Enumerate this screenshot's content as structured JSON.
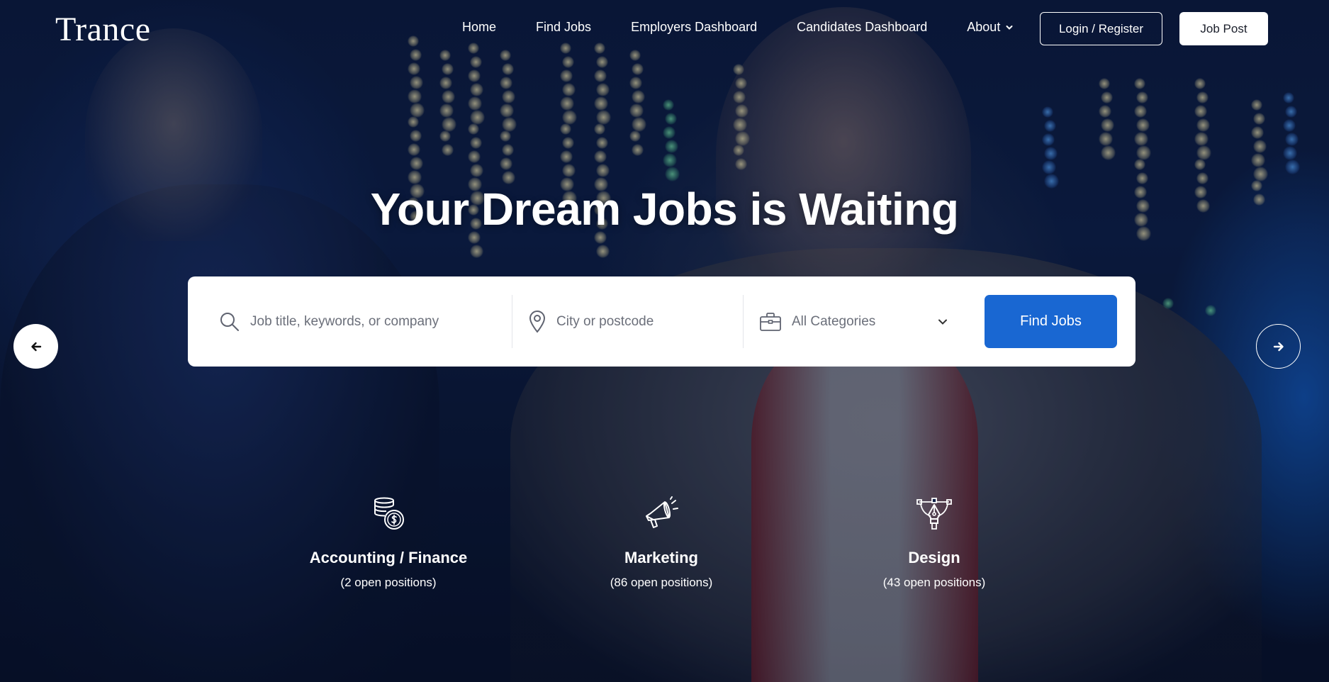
{
  "header": {
    "logo": "Trance",
    "nav": [
      {
        "label": "Home"
      },
      {
        "label": "Find Jobs"
      },
      {
        "label": "Employers Dashboard"
      },
      {
        "label": "Candidates Dashboard"
      },
      {
        "label": "About",
        "has_dropdown": true
      }
    ],
    "login_label": "Login / Register",
    "job_post_label": "Job Post"
  },
  "hero": {
    "headline": "Your Dream Jobs is Waiting"
  },
  "search": {
    "keyword_placeholder": "Job title, keywords, or company",
    "keyword_icon": "search-icon",
    "city_placeholder": "City or postcode",
    "city_icon": "map-pin-icon",
    "category_selected": "All Categories",
    "category_icon": "briefcase-icon",
    "find_label": "Find Jobs",
    "find_color": "#1967d2"
  },
  "slider": {
    "prev_icon": "arrow-left-icon",
    "next_icon": "arrow-right-icon"
  },
  "categories": [
    {
      "title": "Accounting / Finance",
      "count": "(2 open positions)",
      "icon": "coins-icon"
    },
    {
      "title": "Marketing",
      "count": "(86 open positions)",
      "icon": "megaphone-icon"
    },
    {
      "title": "Design",
      "count": "(43 open positions)",
      "icon": "pen-tool-icon"
    }
  ]
}
